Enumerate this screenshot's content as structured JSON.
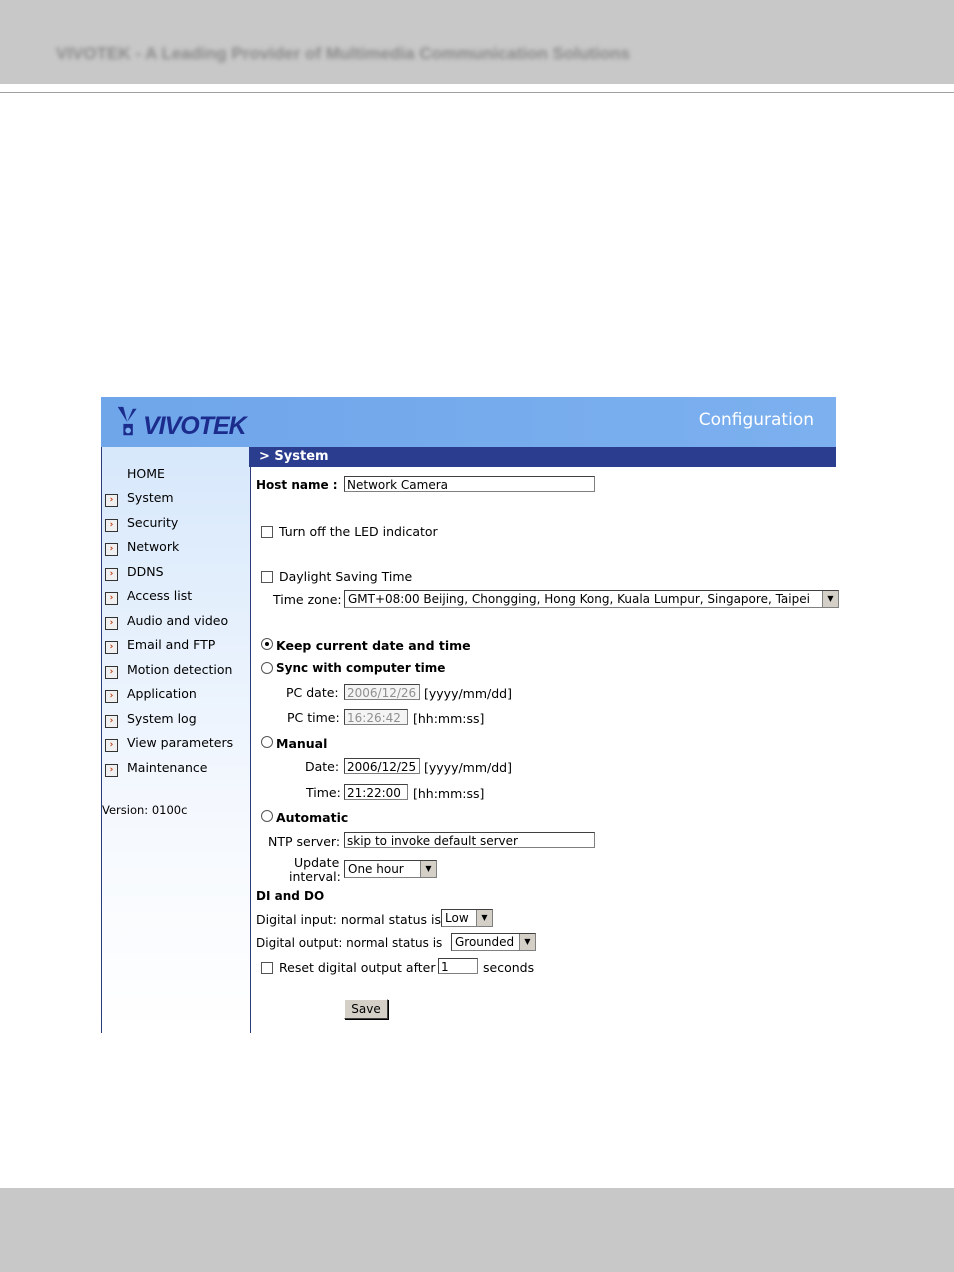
{
  "doc_header": {
    "text": "VIVOTEK - A Leading Provider of Multimedia Communication Solutions"
  },
  "banner": {
    "logo_text": "VIVOTEK",
    "title": "Configuration"
  },
  "sidebar": {
    "home": "HOME",
    "items": [
      "System",
      "Security",
      "Network",
      "DDNS",
      "Access list",
      "Audio and video",
      "Email and FTP",
      "Motion detection",
      "Application",
      "System log",
      "View parameters",
      "Maintenance"
    ],
    "version": "Version: 0100c"
  },
  "section": {
    "title": "> System"
  },
  "form": {
    "host_name_label": "Host name :",
    "host_name_value": "Network Camera",
    "led_label": "Turn off the LED indicator",
    "dst_label": "Daylight Saving Time",
    "tz_label": "Time zone:",
    "tz_value": "GMT+08:00 Beijing, Chongging, Hong Kong, Kuala Lumpur, Singapore, Taipei",
    "keep_label": "Keep current date and time",
    "sync_label": "Sync with computer time",
    "pc_date_label": "PC date:",
    "pc_date_value": "2006/12/26",
    "date_format": "[yyyy/mm/dd]",
    "pc_time_label": "PC time:",
    "pc_time_value": "16:26:42",
    "time_format": "[hh:mm:ss]",
    "manual_label": "Manual",
    "date_label": "Date:",
    "date_value": "2006/12/25",
    "time_label": "Time:",
    "time_value": "21:22:00",
    "auto_label": "Automatic",
    "ntp_label": "NTP server:",
    "ntp_value": "skip to invoke default server",
    "update_label_1": "Update",
    "update_label_2": "interval:",
    "update_value": "One hour",
    "di_do_heading": "DI and DO",
    "di_label": "Digital input: normal status is",
    "di_value": "Low",
    "do_label": "Digital output: normal status is",
    "do_value": "Grounded",
    "reset_label": "Reset digital output after",
    "reset_value": "1",
    "seconds_label": "seconds",
    "save_label": "Save"
  }
}
